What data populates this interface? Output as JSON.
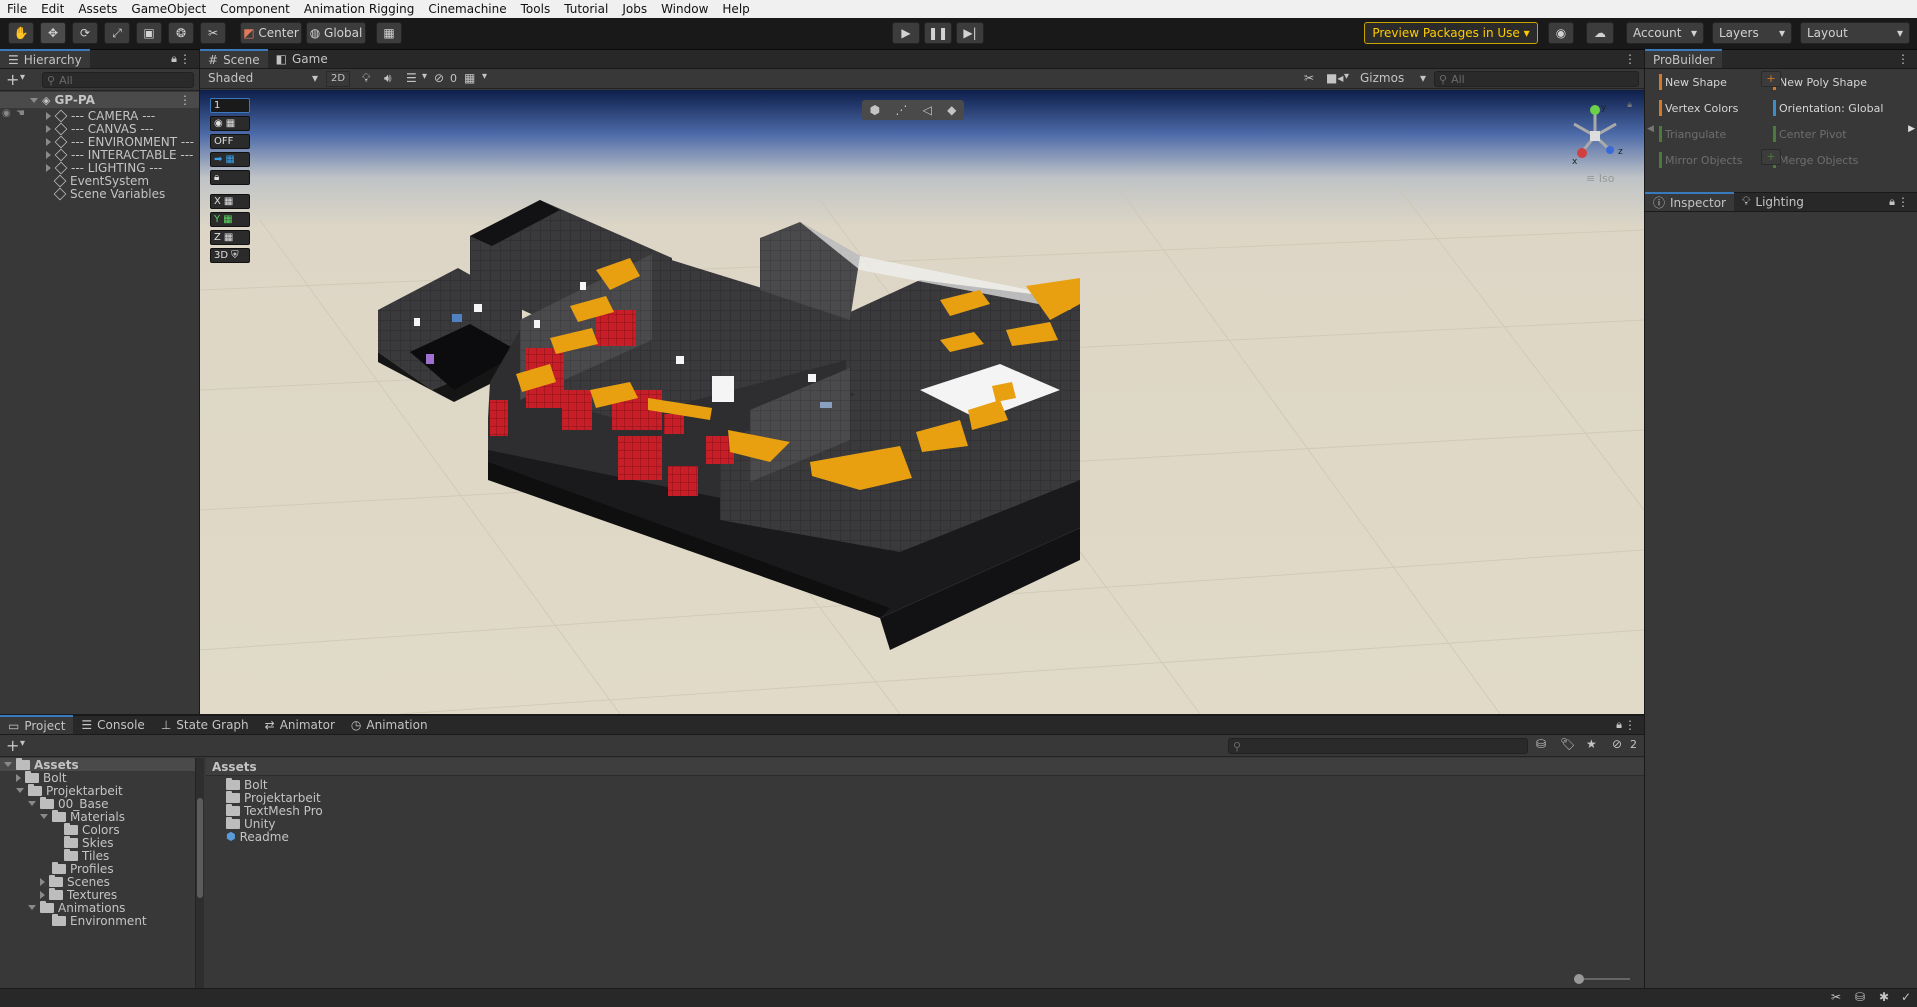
{
  "menu": [
    "File",
    "Edit",
    "Assets",
    "GameObject",
    "Component",
    "Animation Rigging",
    "Cinemachine",
    "Tools",
    "Tutorial",
    "Jobs",
    "Window",
    "Help"
  ],
  "toolbar": {
    "pivot_label": "Center",
    "space_label": "Global",
    "preview_packages": "Preview Packages in Use",
    "account": "Account",
    "layers": "Layers",
    "layout": "Layout"
  },
  "hierarchy": {
    "tab": "Hierarchy",
    "search_placeholder": "All",
    "scene_name": "GP-PA",
    "items": [
      "--- CAMERA ---",
      "--- CANVAS ---",
      "--- ENVIRONMENT ---",
      "--- INTERACTABLE ---",
      "--- LIGHTING ---",
      "EventSystem",
      "Scene Variables"
    ]
  },
  "scene": {
    "tabs": [
      "Scene",
      "Game"
    ],
    "shading_mode": "Shaded",
    "mode_2d": "2D",
    "hidden_count": "0",
    "gizmos": "Gizmos",
    "search_placeholder": "All",
    "persp_label": "Iso",
    "overlay": {
      "layer_field": "1",
      "off_label": "OFF",
      "x": "X",
      "y": "Y",
      "z": "Z",
      "threed": "3D"
    },
    "axes": {
      "x": "x",
      "y": "y",
      "z": "z"
    }
  },
  "probuilder": {
    "tab": "ProBuilder",
    "items": [
      {
        "label": "New Shape",
        "color": "#d4782a",
        "enabled": true
      },
      {
        "label": "New Poly Shape",
        "color": "#d4782a",
        "enabled": true
      },
      {
        "label": "Vertex Colors",
        "color": "#d4782a",
        "enabled": true
      },
      {
        "label": "Orientation: Global",
        "color": "#3a8fc9",
        "enabled": true
      },
      {
        "label": "Triangulate",
        "color": "#4c7a3a",
        "enabled": false
      },
      {
        "label": "Center Pivot",
        "color": "#4c7a3a",
        "enabled": false
      },
      {
        "label": "Mirror Objects",
        "color": "#4c7a3a",
        "enabled": false
      },
      {
        "label": "Merge Objects",
        "color": "#4c7a3a",
        "enabled": false
      }
    ]
  },
  "inspector_tabs": [
    "Inspector",
    "Lighting"
  ],
  "bottom_tabs": [
    "Project",
    "Console",
    "State Graph",
    "Animator",
    "Animation"
  ],
  "project": {
    "tree": [
      {
        "label": "Assets",
        "depth": 0,
        "arrow": "down",
        "bold": true
      },
      {
        "label": "Bolt",
        "depth": 1,
        "arrow": "right"
      },
      {
        "label": "Projektarbeit",
        "depth": 1,
        "arrow": "down"
      },
      {
        "label": "00_Base",
        "depth": 2,
        "arrow": "down"
      },
      {
        "label": "Materials",
        "depth": 3,
        "arrow": "down"
      },
      {
        "label": "Colors",
        "depth": 4,
        "arrow": ""
      },
      {
        "label": "Skies",
        "depth": 4,
        "arrow": ""
      },
      {
        "label": "Tiles",
        "depth": 4,
        "arrow": ""
      },
      {
        "label": "Profiles",
        "depth": 3,
        "arrow": ""
      },
      {
        "label": "Scenes",
        "depth": 3,
        "arrow": "right"
      },
      {
        "label": "Textures",
        "depth": 3,
        "arrow": "right"
      },
      {
        "label": "Animations",
        "depth": 2,
        "arrow": "down"
      },
      {
        "label": "Environment",
        "depth": 3,
        "arrow": ""
      }
    ],
    "breadcrumb": "Assets",
    "files": [
      "Bolt",
      "Projektarbeit",
      "TextMesh Pro",
      "Unity",
      "Readme"
    ],
    "hidden_count": "2"
  }
}
